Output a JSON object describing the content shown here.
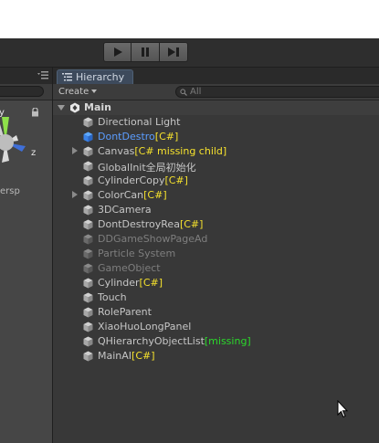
{
  "toolbar": {
    "play_icon": "play-icon",
    "pause_icon": "pause-icon",
    "step_icon": "step-icon"
  },
  "scene_view": {
    "axis_y": "y",
    "axis_z": "z",
    "persp_label": "ersp"
  },
  "hierarchy": {
    "tab_label": "Hierarchy",
    "create_label": "Create",
    "search_placeholder": "All",
    "scene_name": "Main",
    "items": [
      {
        "name": "Directional Light",
        "tag": "",
        "tag_color": "",
        "expandable": false,
        "style": "normal"
      },
      {
        "name": "DontDestro",
        "tag": "[C#]",
        "tag_color": "yellow",
        "expandable": false,
        "style": "prefab"
      },
      {
        "name": "Canvas",
        "tag": "[C# missing child]",
        "tag_color": "yellow",
        "expandable": true,
        "style": "normal"
      },
      {
        "name": "GlobalInit全局初始化",
        "tag": "",
        "tag_color": "",
        "expandable": false,
        "style": "normal"
      },
      {
        "name": "CylinderCopy",
        "tag": "[C#]",
        "tag_color": "yellow",
        "expandable": false,
        "style": "normal"
      },
      {
        "name": "ColorCan",
        "tag": "[C#]",
        "tag_color": "yellow",
        "expandable": true,
        "style": "normal"
      },
      {
        "name": "3DCamera",
        "tag": "",
        "tag_color": "",
        "expandable": false,
        "style": "normal"
      },
      {
        "name": "DontDestroyRea",
        "tag": "[C#]",
        "tag_color": "yellow",
        "expandable": false,
        "style": "normal"
      },
      {
        "name": "DDGameShowPageAd",
        "tag": "",
        "tag_color": "",
        "expandable": false,
        "style": "inactive"
      },
      {
        "name": "Particle System",
        "tag": "",
        "tag_color": "",
        "expandable": false,
        "style": "inactive"
      },
      {
        "name": "GameObject",
        "tag": "",
        "tag_color": "",
        "expandable": false,
        "style": "inactive"
      },
      {
        "name": "Cylinder",
        "tag": "[C#]",
        "tag_color": "yellow",
        "expandable": false,
        "style": "normal"
      },
      {
        "name": "Touch",
        "tag": "",
        "tag_color": "",
        "expandable": false,
        "style": "normal"
      },
      {
        "name": "RoleParent",
        "tag": "",
        "tag_color": "",
        "expandable": false,
        "style": "normal"
      },
      {
        "name": "XiaoHuoLongPanel",
        "tag": "",
        "tag_color": "",
        "expandable": false,
        "style": "normal"
      },
      {
        "name": "QHierarchyObjectList",
        "tag": "[missing]",
        "tag_color": "green",
        "expandable": false,
        "style": "normal"
      },
      {
        "name": "MainAI",
        "tag": "[C#]",
        "tag_color": "yellow",
        "expandable": false,
        "style": "normal"
      }
    ]
  },
  "colors": {
    "panel_bg": "#383838",
    "toolbar_bg": "#2e2e2e",
    "prefab_blue": "#5b9dff",
    "tag_yellow": "#f5e12d",
    "tag_green": "#2bd92b",
    "inactive_gray": "#7e7e7e"
  }
}
